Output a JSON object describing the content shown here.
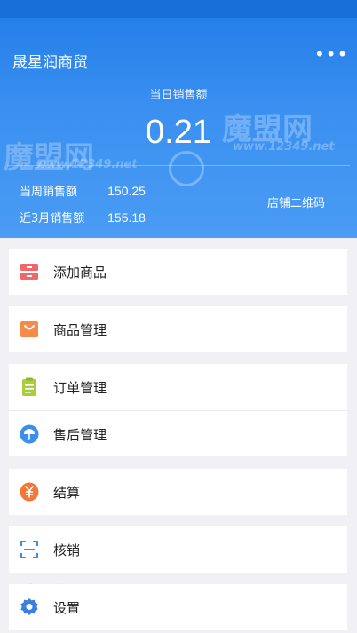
{
  "header": {
    "shop_name": "晟星润商贸",
    "more_label": "•••",
    "today_label": "当日销售额",
    "today_value": "0.21",
    "week_label": "当周销售额",
    "week_value": "150.25",
    "three_month_label": "近3月销售额",
    "three_month_value": "155.18",
    "qr_label": "店铺二维码",
    "watermark_text": "魔盟网",
    "watermark_url": "www.12349.net"
  },
  "menu": {
    "add_product": "添加商品",
    "product_manage": "商品管理",
    "order_manage": "订单管理",
    "after_sale": "售后管理",
    "settlement": "结算",
    "verify": "核销",
    "settings": "设置"
  },
  "colors": {
    "header_blue": "#3a8ff0",
    "icon_red": "#f0676a",
    "icon_orange": "#f58a4a",
    "icon_green": "#a8cf3a",
    "icon_blue": "#3b8fe8",
    "icon_settle": "#f0793a",
    "icon_settings": "#3b7fe0"
  }
}
